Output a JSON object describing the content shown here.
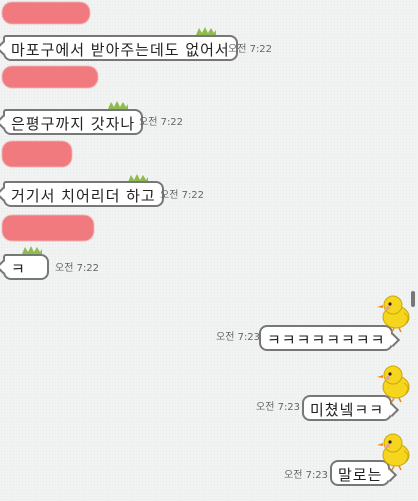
{
  "messages": [
    {
      "side": "left",
      "text": "마포구에서 받아주는데도 없어서",
      "time": "오전 7:22"
    },
    {
      "side": "left",
      "text": "은평구까지 갓자나",
      "time": "오전 7:22"
    },
    {
      "side": "left",
      "text": "거기서 치어리더 하고",
      "time": "오전 7:22"
    },
    {
      "side": "left",
      "text": "ㅋ",
      "time": "오전 7:22"
    },
    {
      "side": "right",
      "text": "ㅋㅋㅋㅋㅋㅋㅋㅋ",
      "time": "오전 7:23"
    },
    {
      "side": "right",
      "text": "미쳤넼ㅋㅋ",
      "time": "오전 7:23"
    },
    {
      "side": "right",
      "text": "말로는",
      "time": "오전 7:23"
    }
  ],
  "colors": {
    "redaction": "#f07075",
    "bubble_border": "#777777",
    "chick": "#f5d51d",
    "grass": "#8dbb4c"
  },
  "icons": {
    "chick": "chick-sticker-icon",
    "grass": "grass-tuft-icon"
  }
}
